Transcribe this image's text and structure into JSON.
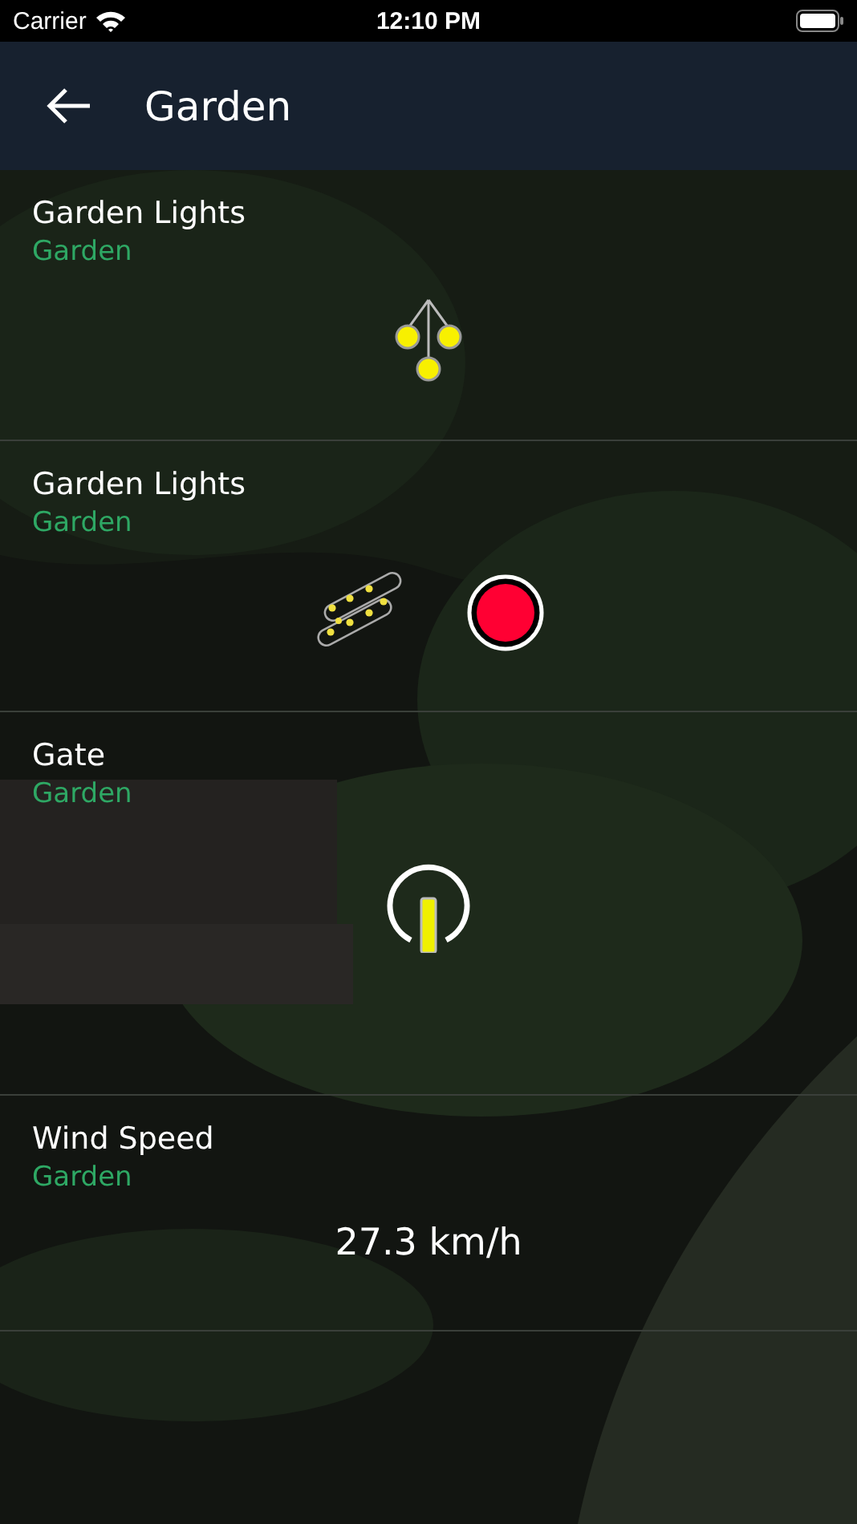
{
  "status_bar": {
    "carrier": "Carrier",
    "time": "12:10 PM"
  },
  "header": {
    "title": "Garden"
  },
  "devices": [
    {
      "kind": "light",
      "name": "Garden Lights",
      "room": "Garden"
    },
    {
      "kind": "strip",
      "name": "Garden Lights",
      "room": "Garden",
      "color": "#ff0033"
    },
    {
      "kind": "switch",
      "name": "Gate",
      "room": "Garden",
      "on": true
    },
    {
      "kind": "sensor",
      "name": "Wind Speed",
      "room": "Garden",
      "value": "27.3 km/h"
    }
  ]
}
